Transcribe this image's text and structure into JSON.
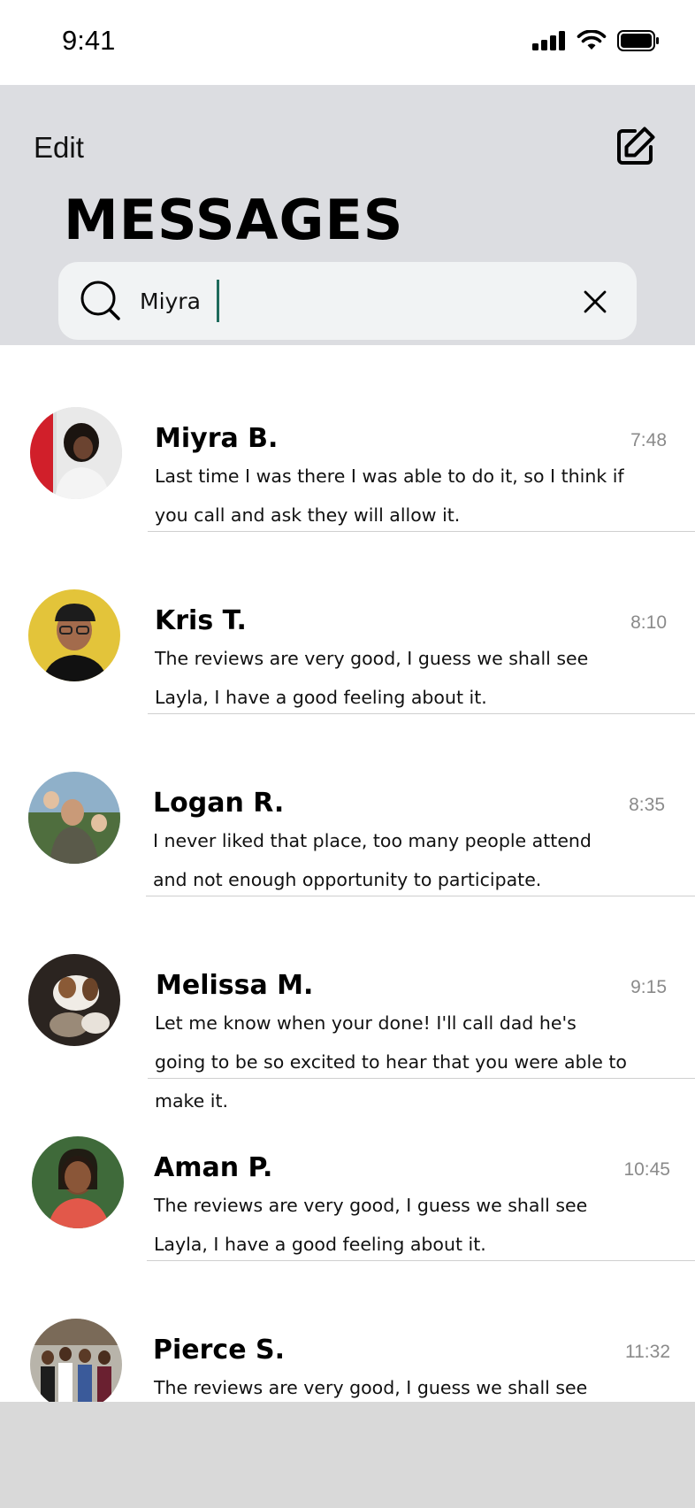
{
  "status_bar": {
    "time": "9:41"
  },
  "header": {
    "edit_label": "Edit",
    "title": "MESSAGES"
  },
  "search": {
    "value": "Miyra"
  },
  "conversations": [
    {
      "name": "Miyra B.",
      "time": "7:48",
      "preview": "Last time I was there I was able to do it, so I think if you call and ask they will allow it."
    },
    {
      "name": "Kris T.",
      "time": "8:10",
      "preview": "The reviews are very good, I guess we shall see Layla, I have a good feeling about it."
    },
    {
      "name": "Logan R.",
      "time": "8:35",
      "preview": "I never liked that place, too many people attend and not enough opportunity to participate."
    },
    {
      "name": "Melissa M.",
      "time": "9:15",
      "preview": "Let me know when your done! I'll call dad he's going to be so excited to hear that you were able to make it."
    },
    {
      "name": "Aman P.",
      "time": "10:45",
      "preview": "The reviews are very good, I guess we shall see Layla, I have a good feeling about it."
    },
    {
      "name": "Pierce S.",
      "time": "11:32",
      "preview": "The reviews are very good, I guess we shall see Layla, I have"
    }
  ],
  "colors": {
    "header_bg": "#dcdde1",
    "search_bg": "#f1f3f4",
    "cursor": "#1f6b5c",
    "bottom_bar": "#d9d9d9"
  }
}
